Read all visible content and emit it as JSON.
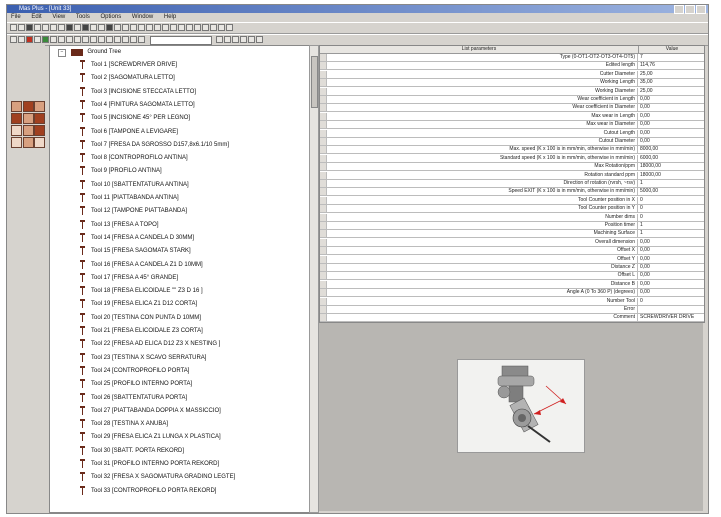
{
  "window": {
    "title": "Mas Plus - [Unit 33]"
  },
  "menu": [
    "File",
    "Edit",
    "View",
    "Tools",
    "Options",
    "Window",
    "Help"
  ],
  "tree": {
    "root_label": "Ground Tree",
    "items": [
      "Tool 1 [SCREWDRIVER DRIVE]",
      "Tool 2 [SAGOMATURA LETTO]",
      "Tool 3 [INCISIONE STECCATA LETTO]",
      "Tool 4 [FINITURA SAGOMATA LETTO]",
      "Tool 5 [INCISIONE 45° PER LEGNO]",
      "Tool 6 [TAMPONE A LEVIGARE]",
      "Tool 7 [FRESA DA SGROSSO D157,8x6.1/10 5mm]",
      "Tool 8 [CONTROPROFILO ANTINA]",
      "Tool 9 [PROFILO ANTINA]",
      "Tool 10 [SBATTENTATURA ANTINA]",
      "Tool 11 [PIATTABANDA ANTINA]",
      "Tool 12 [TAMPONE PIATTABANDA]",
      "Tool 13 [FRESA A TOPO]",
      "Tool 14 [FRESA A CANDELA D 30MM]",
      "Tool 15 [FRESA SAGOMATA STARK]",
      "Tool 16 [FRESA A CANDELA Z1 D 10MM]",
      "Tool 17 [FRESA A 45° GRANDE]",
      "Tool 18 [FRESA ELICOIDALE \"\" Z3 D 16 ]",
      "Tool 19 [FRESA ELICA Z1 D12 CORTA]",
      "Tool 20 [TESTINA CON PUNTA D 10MM]",
      "Tool 21 [FRESA ELICOIDALE Z3 CORTA]",
      "Tool 22 [FRESA AD ELICA D12 Z3 X NESTING ]",
      "Tool 23 [TESTINA X SCAVO SERRATURA]",
      "Tool 24 [CONTROPROFILO PORTA]",
      "Tool 25 [PROFILO INTERNO PORTA]",
      "Tool 26 [SBATTENTATURA PORTA]",
      "Tool 27 [PIATTABANDA DOPPIA X MASSICCIO]",
      "Tool 28 [TESTINA X ANUBA]",
      "Tool 29 [FRESA ELICA Z1 LUNGA X PLASTICA]",
      "Tool 30 [SBATT. PORTA REKORD]",
      "Tool 31 [PROFILO INTERNO PORTA REKORD]",
      "Tool 32 [FRESA X SAGOMATURA GRADINO LEGTE]",
      "Tool 33 [CONTROPROFILO PORTA REKORD]"
    ]
  },
  "grid": {
    "header_name": "List parameters",
    "header_value": "Value",
    "rows": [
      {
        "name": "Type (0-OT1-OT2-OT3-OT4-OT5)",
        "value": "7"
      },
      {
        "name": "Edited length",
        "value": "114,76"
      },
      {
        "name": "Cutter Diameter",
        "value": "25,00"
      },
      {
        "name": "Working Length",
        "value": "35,00"
      },
      {
        "name": "Working Diameter",
        "value": "25,00"
      },
      {
        "name": "Wear coefficient in Length",
        "value": "0,00"
      },
      {
        "name": "Wear coefficient in Diameter",
        "value": "0,00"
      },
      {
        "name": "Max wear in Length",
        "value": "0,00"
      },
      {
        "name": "Max wear in Diameter",
        "value": "0,00"
      },
      {
        "name": "Cutout Length",
        "value": "0,00"
      },
      {
        "name": "Cutout Diameter",
        "value": "0,00"
      },
      {
        "name": "Max. speed (K x 100 is in mm/min, otherwise in mm/min)",
        "value": "8000,00"
      },
      {
        "name": "Standard speed (K x 100 is in mm/min, otherwise in mm/min)",
        "value": "6000,00"
      },
      {
        "name": "Max Rotation/ppm",
        "value": "18000,00"
      },
      {
        "name": "Rotation standard ppm",
        "value": "18000,00"
      },
      {
        "name": "Direction of rotation (rvrsh, ~rsv)",
        "value": "1"
      },
      {
        "name": "Speed EXIT (K x 100 is in mm/min, otherwise in mm/min)",
        "value": "5000,00"
      },
      {
        "name": "Tool Counter position in X",
        "value": "0"
      },
      {
        "name": "Tool Counter position in Y",
        "value": "0"
      },
      {
        "name": "Number dims",
        "value": "0"
      },
      {
        "name": "Position timer",
        "value": "1"
      },
      {
        "name": "Machining Surface",
        "value": "1"
      },
      {
        "name": "Overall dimension",
        "value": "0,00"
      },
      {
        "name": "Offset X",
        "value": "0,00"
      },
      {
        "name": "Offset Y",
        "value": "0,00"
      },
      {
        "name": "Distance Z",
        "value": "0,00"
      },
      {
        "name": "Offset L",
        "value": "0,00"
      },
      {
        "name": "Distance B",
        "value": "0,00"
      },
      {
        "name": "Angle A (0 To 360 P) (degrees)",
        "value": "0,00"
      },
      {
        "name": "Number Tool",
        "value": "0"
      },
      {
        "name": "Error",
        "value": ""
      },
      {
        "name": "Comment",
        "value": "SCREWDRIVER DRIVE"
      }
    ]
  },
  "colors": {
    "titlebar": "#3b5fb0",
    "window": "#d6d3ce",
    "tool_icon": "#6a2a1a",
    "preview_bg": "#b8b6b2",
    "dimension_arrow": "#d02020"
  }
}
